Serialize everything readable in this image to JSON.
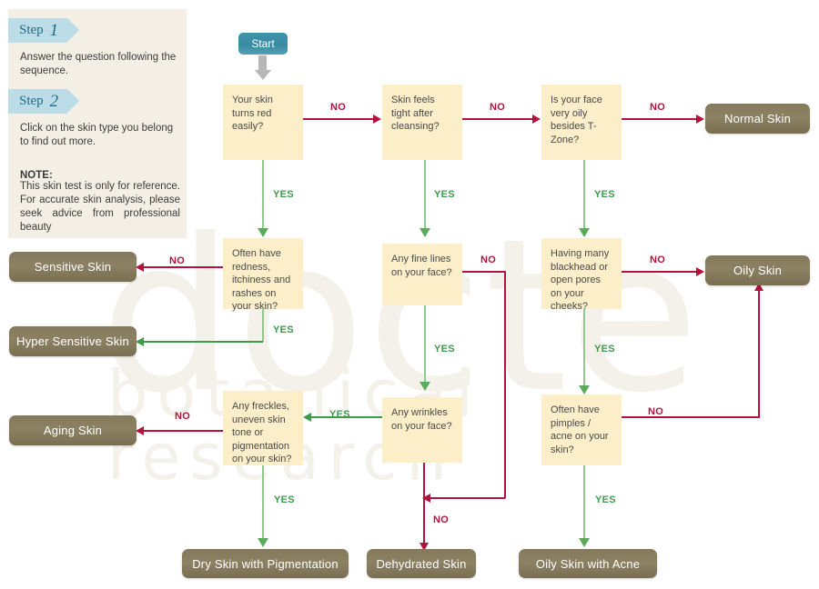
{
  "watermark": {
    "main": "docte",
    "sub": "botanical research"
  },
  "panel": {
    "step1": {
      "word": "Step",
      "num": "1",
      "text": "Answer the question following the sequence."
    },
    "step2": {
      "word": "Step",
      "num": "2",
      "text": "Click on the skin type you belong to find out more."
    },
    "note_label": "NOTE:",
    "note_body": "This skin test is only for reference. For accurate skin analysis, please seek advice from professional beauty"
  },
  "start": {
    "label": "Start"
  },
  "questions": {
    "q1": "Your skin turns red easily?",
    "q2": "Skin feels tight after cleansing?",
    "q3": "Is your face very oily besides T-Zone?",
    "q4": "Often have redness, itchiness and rashes on your skin?",
    "q5": "Any fine lines on your face?",
    "q6": "Having many blackhead or open pores on your cheeks?",
    "q7": "Any freckles, uneven skin tone or pigmentation on your skin?",
    "q8": "Any wrinkles on your face?",
    "q9": "Often have pimples / acne on your skin?"
  },
  "results": {
    "normal": "Normal Skin",
    "sensitive": "Sensitive Skin",
    "hyper_sensitive": "Hyper Sensitive Skin",
    "oily": "Oily Skin",
    "aging": "Aging Skin",
    "dry_pigmentation": "Dry Skin with Pigmentation",
    "dehydrated": "Dehydrated Skin",
    "oily_acne": "Oily Skin with Acne"
  },
  "labels": {
    "no": "NO",
    "yes": "YES",
    "no_q1": "NO",
    "yes_q1": "YES",
    "no_q2": "NO",
    "yes_q2": "YES",
    "no_q3": "NO",
    "yes_q3": "YES",
    "no_q4": "NO",
    "yes_q4": "YES",
    "no_q5": "NO",
    "yes_q5": "YES",
    "no_q6": "NO",
    "yes_q6": "YES",
    "no_q7": "NO",
    "yes_q7": "YES",
    "no_q8": "NO",
    "yes_q8": "YES",
    "no_q9": "NO",
    "yes_q9": "YES"
  },
  "colors": {
    "question_box": "#fbeec9",
    "result_box": "#85795c",
    "start_box": "#3a8aa3",
    "no_line": "#b3123c",
    "yes_line": "#3d9b4c",
    "panel_bg": "#f3efe4",
    "step_tag": "#bcdce8"
  }
}
